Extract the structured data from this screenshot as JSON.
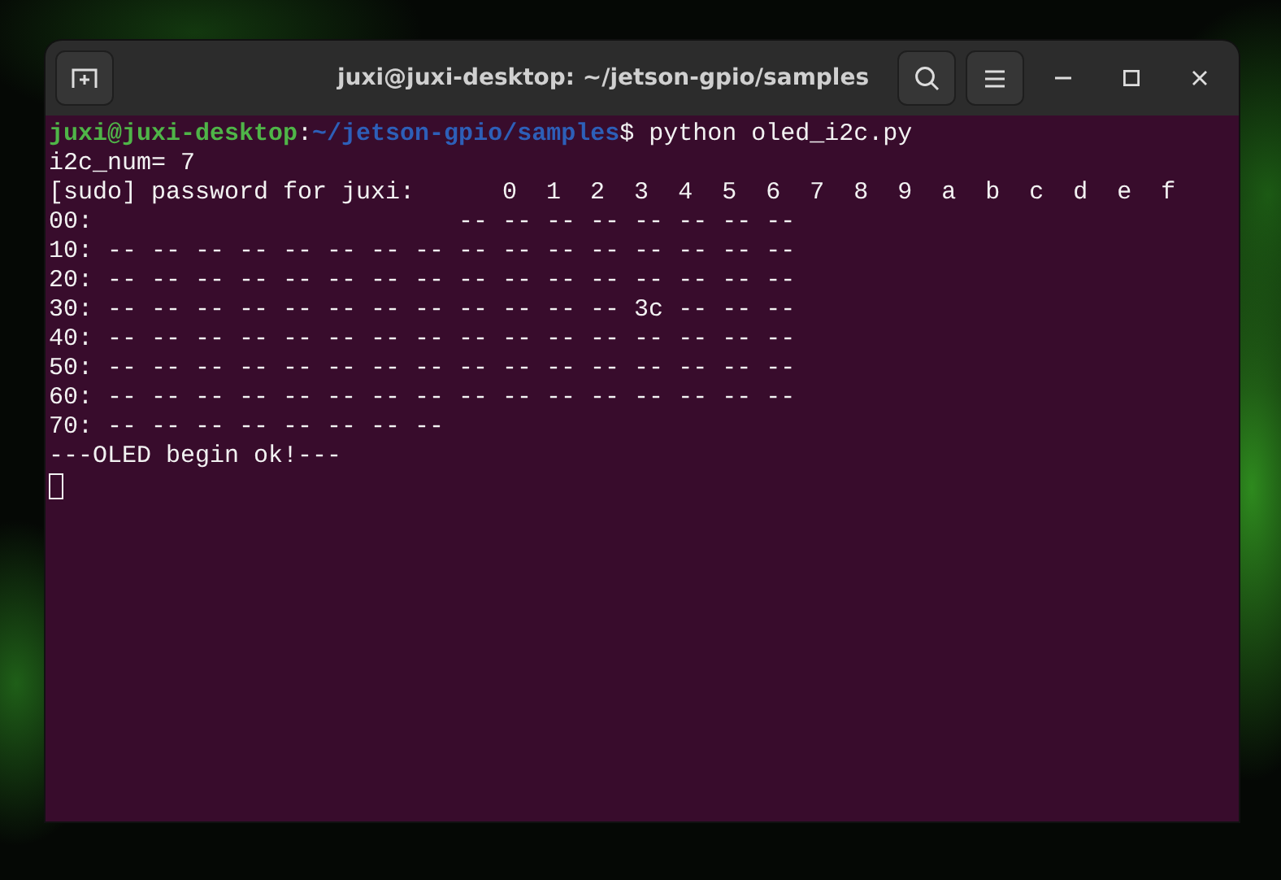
{
  "window": {
    "title": "juxi@juxi-desktop: ~/jetson-gpio/samples"
  },
  "terminal": {
    "prompt": {
      "user_host": "juxi@juxi-desktop",
      "separator": ":",
      "path": "~/jetson-gpio/samples",
      "symbol": "$",
      "command": " python oled_i2c.py"
    },
    "output": [
      "i2c_num= 7",
      "[sudo] password for juxi:      0  1  2  3  4  5  6  7  8  9  a  b  c  d  e  f",
      "00:                         -- -- -- -- -- -- -- --",
      "10: -- -- -- -- -- -- -- -- -- -- -- -- -- -- -- --",
      "20: -- -- -- -- -- -- -- -- -- -- -- -- -- -- -- --",
      "30: -- -- -- -- -- -- -- -- -- -- -- -- 3c -- -- --",
      "40: -- -- -- -- -- -- -- -- -- -- -- -- -- -- -- --",
      "50: -- -- -- -- -- -- -- -- -- -- -- -- -- -- -- --",
      "60: -- -- -- -- -- -- -- -- -- -- -- -- -- -- -- --",
      "70: -- -- -- -- -- -- -- --",
      "---OLED begin ok!---"
    ]
  }
}
